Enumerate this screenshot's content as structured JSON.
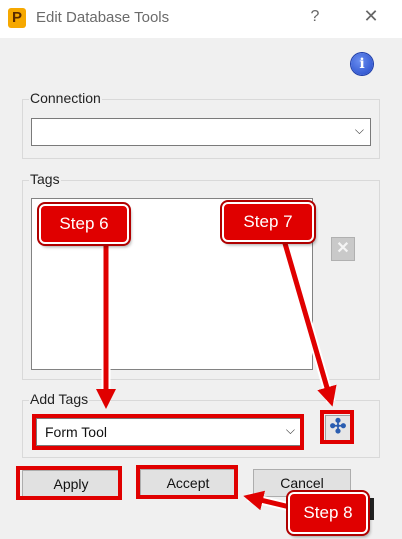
{
  "window": {
    "app_icon_letter": "P",
    "title": "Edit Database Tools",
    "help_glyph": "?",
    "close_glyph": "✕"
  },
  "info_glyph": "i",
  "connection": {
    "label": "Connection",
    "value": "",
    "chevron": "⌵"
  },
  "tags": {
    "label": "Tags",
    "remove_glyph": "✕"
  },
  "add_tags": {
    "label": "Add Tags",
    "value": "Form Tool",
    "chevron": "⌵",
    "add_glyph": "✣"
  },
  "buttons": {
    "apply": "Apply",
    "accept": "Accept",
    "cancel": "Cancel"
  },
  "annotations": {
    "step6": "Step 6",
    "step7": "Step 7",
    "step8": "Step 8",
    "color": "#e00000"
  }
}
